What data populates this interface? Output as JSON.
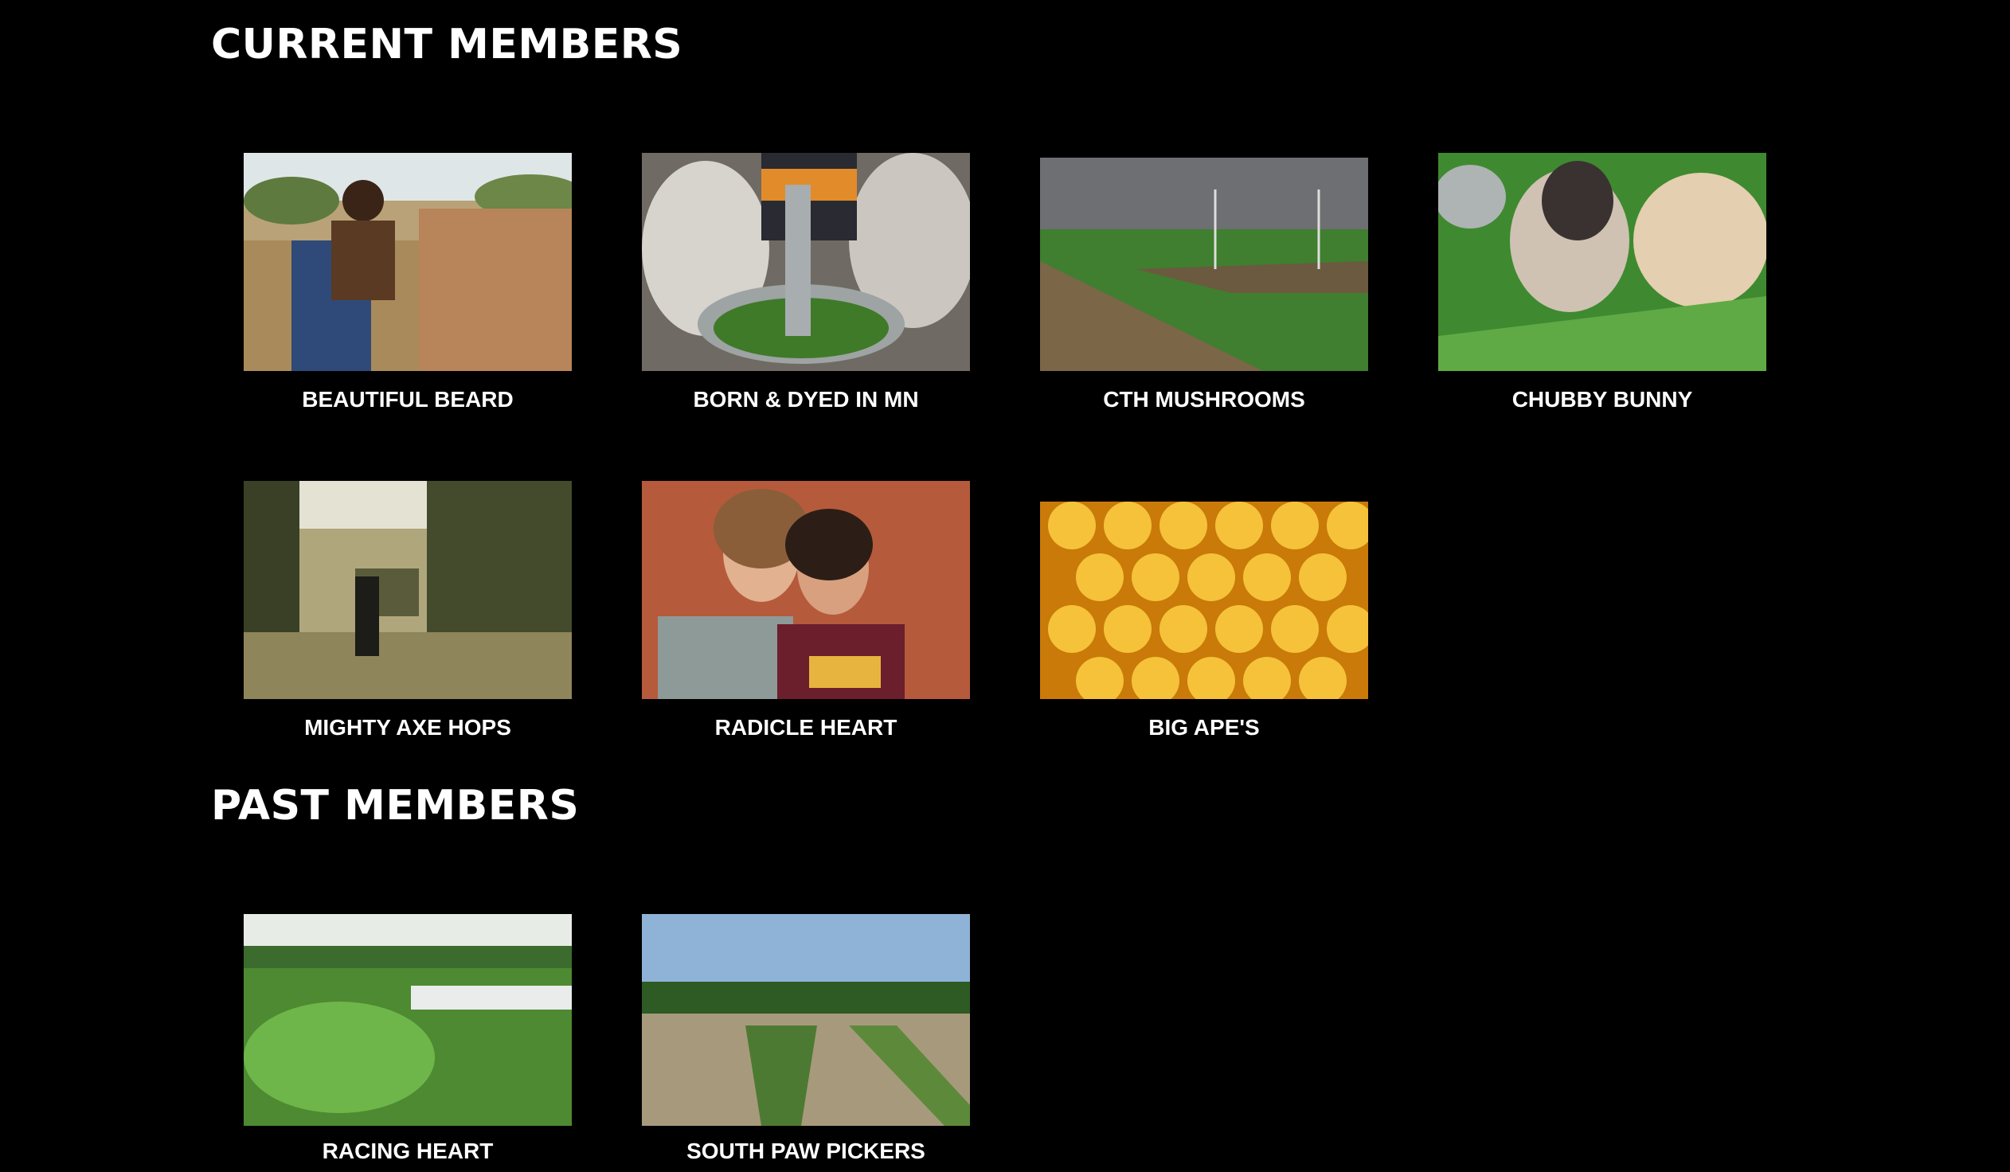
{
  "sections": {
    "current": {
      "title": "CURRENT MEMBERS",
      "members": [
        {
          "name": "BEAUTIFUL BEARD"
        },
        {
          "name": "BORN & DYED IN MN"
        },
        {
          "name": "CTH MUSHROOMS"
        },
        {
          "name": "CHUBBY BUNNY"
        },
        {
          "name": "MIGHTY AXE HOPS"
        },
        {
          "name": "RADICLE HEART"
        },
        {
          "name": "BIG APE'S"
        }
      ]
    },
    "past": {
      "title": "PAST MEMBERS",
      "members": [
        {
          "name": "RACING HEART"
        },
        {
          "name": "SOUTH PAW PICKERS"
        }
      ]
    }
  },
  "colors": {
    "background": "#000000",
    "text": "#ffffff"
  }
}
